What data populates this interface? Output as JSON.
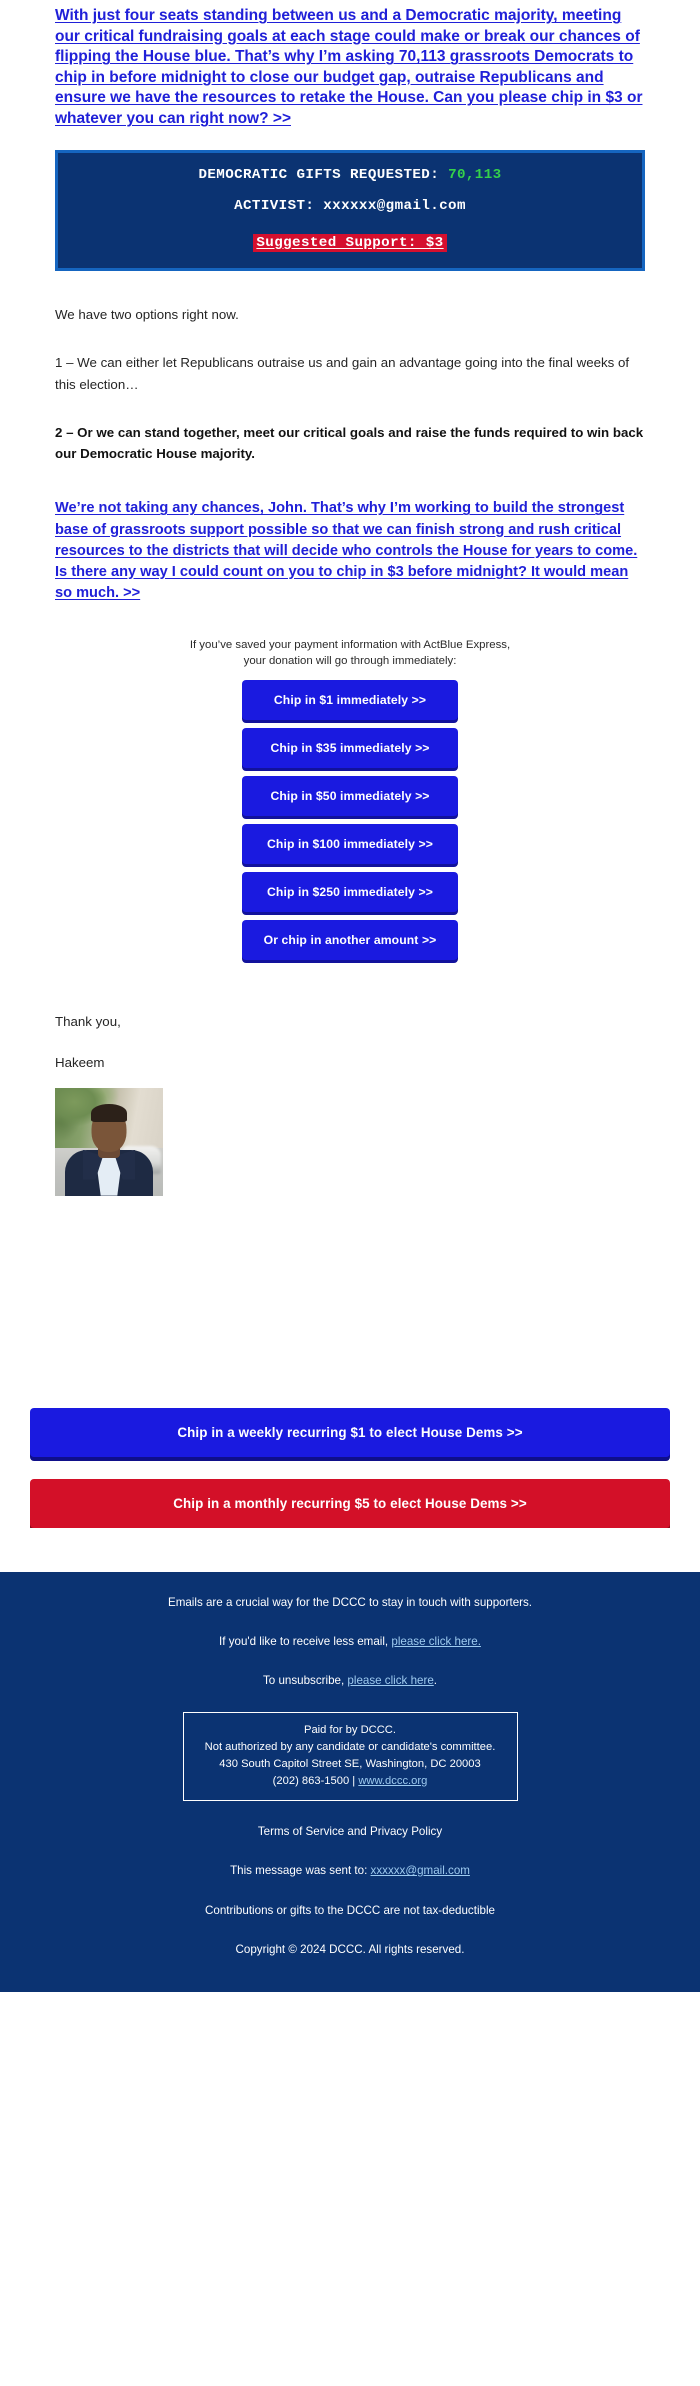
{
  "colors": {
    "link_blue": "#2020d8",
    "navy": "#0b3372",
    "box_border_blue": "#1565c0",
    "green": "#35d14a",
    "red": "#d50f2e",
    "button_blue": "#1a1ae0",
    "button_red": "#d31028",
    "footer_link": "#9ecbf0"
  },
  "lead": {
    "text": "With just four seats standing between us and a Democratic majority, meeting our critical fundraising goals at each stage could make or break our chances of flipping the House blue. That’s why I’m asking 70,113 grassroots Democrats to chip in before midnight to close our budget gap, outraise Republicans and ensure we have the resources to retake the House. Can you please chip in $3 or whatever you can right now? >>"
  },
  "stats_box": {
    "gifts_label": "DEMOCRATIC GIFTS REQUESTED:",
    "gifts_value": "70,113",
    "activist_label": "ACTIVIST:",
    "activist_value": "xxxxxx@gmail.com",
    "suggested": "Suggested Support: $3"
  },
  "body": {
    "intro": "We have two options right now.",
    "option_1": "1 – We can either let Republicans outraise us and gain an advantage going into the final weeks of this election…",
    "option_2": "2 – Or we can stand together, meet our critical goals and raise the funds required to win back our Democratic House majority.",
    "closing_link": "We’re not taking any chances, John. That’s why I’m working to build the strongest base of grassroots support possible so that we can finish strong and rush critical resources to the districts that will decide who controls the House for years to come. Is there any way I could count on you to chip in $3 before midnight? It would mean so much. >>"
  },
  "actblue": {
    "note_line_1": "If you’ve saved your payment information with ActBlue Express,",
    "note_line_2": "your donation will go through immediately:"
  },
  "chip_buttons": [
    {
      "label": "Chip in $1 immediately >>"
    },
    {
      "label": "Chip in $35 immediately >>"
    },
    {
      "label": "Chip in $50 immediately >>"
    },
    {
      "label": "Chip in $100 immediately >>"
    },
    {
      "label": "Chip in $250 immediately >>"
    },
    {
      "label": "Or chip in another amount >>"
    }
  ],
  "signature": {
    "thanks": "Thank you,",
    "name": "Hakeem"
  },
  "recurring": {
    "weekly_label": "Chip in a weekly recurring $1 to elect House Dems >>",
    "monthly_label": "Chip in a monthly recurring $5 to elect House Dems >>"
  },
  "footer": {
    "line_1": "Emails are a crucial way for the DCCC to stay in touch with supporters.",
    "less_email_prefix": "If you'd like to receive less email, ",
    "less_email_link": "please click here.",
    "unsubscribe_prefix": "To unsubscribe, ",
    "unsubscribe_link": "please click here",
    "unsubscribe_suffix": ".",
    "address": {
      "line_1": "Paid for by DCCC.",
      "line_2": "Not authorized by any candidate or candidate's committee.",
      "line_3": "430 South Capitol Street SE, Washington, DC 20003",
      "line_4_phone": "(202) 863-1500 | ",
      "line_4_link": "www.dccc.org"
    },
    "terms": "Terms of Service and Privacy Policy",
    "sent_to_prefix": "This message was sent to: ",
    "sent_to_email": "xxxxxx@gmail.com",
    "tax": "Contributions or gifts to the DCCC are not tax-deductible",
    "copyright": "Copyright © 2024 DCCC. All rights reserved."
  }
}
